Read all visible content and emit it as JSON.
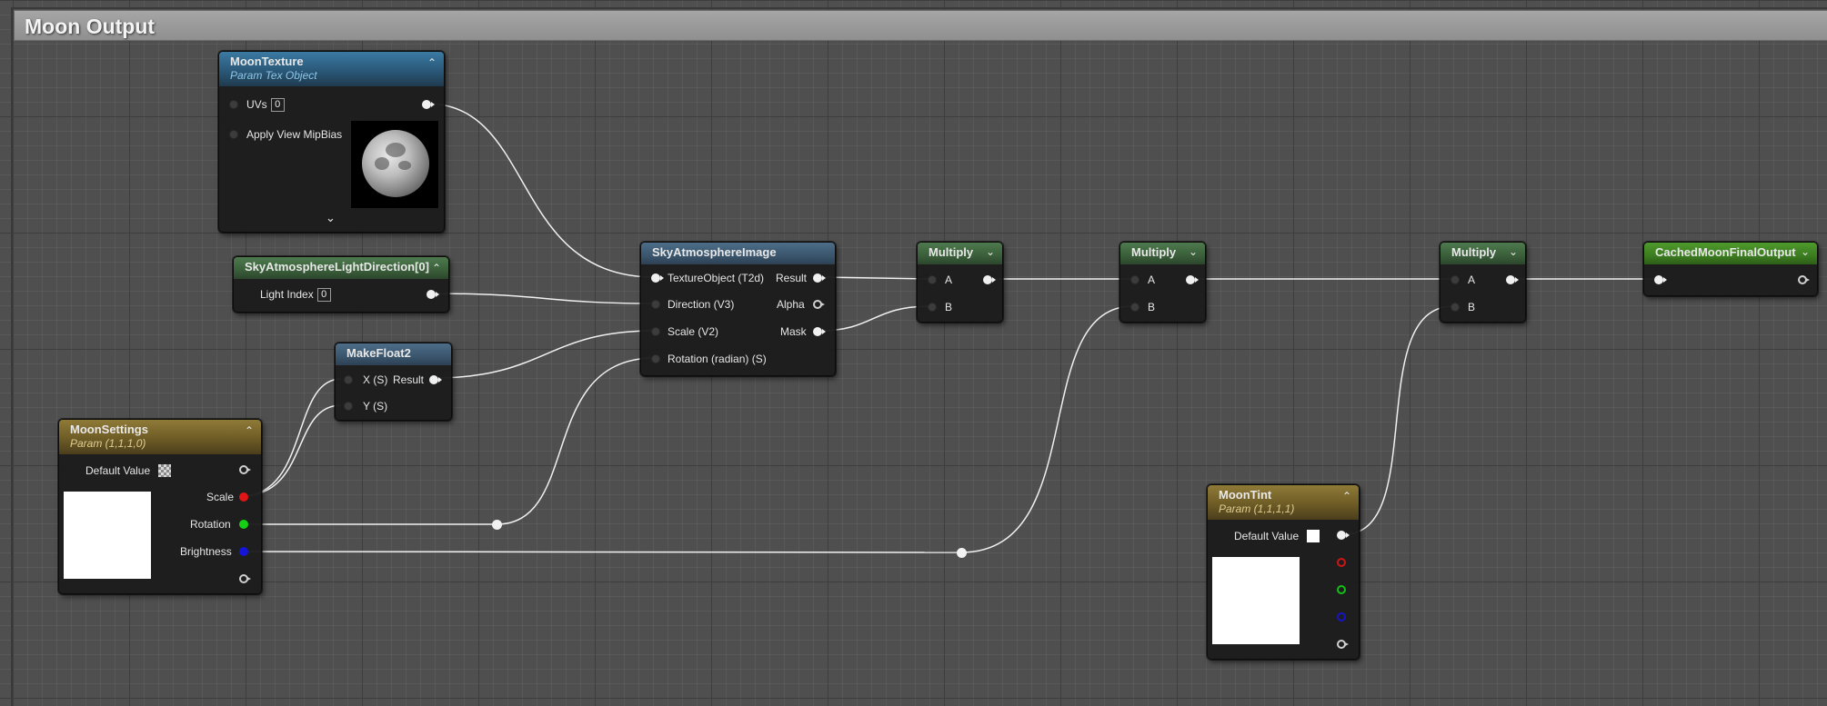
{
  "comment": {
    "title": "Moon Output"
  },
  "nodes": {
    "moon_texture": {
      "title": "MoonTexture",
      "subtitle": "Param Tex Object",
      "uvs_label": "UVs",
      "uvs_value": "0",
      "mipbias_label": "Apply View MipBias",
      "expand_icon": "chevron-down-icon",
      "collapse_icon": "chevron-up-icon"
    },
    "light_direction": {
      "title": "SkyAtmosphereLightDirection[0]",
      "light_index_label": "Light Index",
      "light_index_value": "0"
    },
    "make_float2": {
      "title": "MakeFloat2",
      "x_label": "X (S)",
      "y_label": "Y (S)",
      "result_label": "Result"
    },
    "sky_image": {
      "title": "SkyAtmosphereImage",
      "inputs": [
        "TextureObject (T2d)",
        "Direction (V3)",
        "Scale (V2)",
        "Rotation (radian) (S)"
      ],
      "outputs": [
        "Result",
        "Alpha",
        "Mask"
      ]
    },
    "multiply_1": {
      "title": "Multiply",
      "a_label": "A",
      "b_label": "B"
    },
    "multiply_2": {
      "title": "Multiply",
      "a_label": "A",
      "b_label": "B"
    },
    "multiply_3": {
      "title": "Multiply",
      "a_label": "A",
      "b_label": "B"
    },
    "cached_output": {
      "title": "CachedMoonFinalOutput"
    },
    "moon_settings": {
      "title": "MoonSettings",
      "subtitle": "Param (1,1,1,0)",
      "default_value_label": "Default Value",
      "scale_label": "Scale",
      "rotation_label": "Rotation",
      "brightness_label": "Brightness"
    },
    "moon_tint": {
      "title": "MoonTint",
      "subtitle": "Param (1,1,1,1)",
      "default_value_label": "Default Value"
    }
  },
  "colors": {
    "wire": "#f0f0f0",
    "pin_red": "#e01515",
    "pin_green": "#15d015",
    "pin_blue": "#1515d8",
    "header_param": "#8f7a37",
    "header_texture": "#3b7aa3",
    "header_output": "#4e9a2c"
  }
}
